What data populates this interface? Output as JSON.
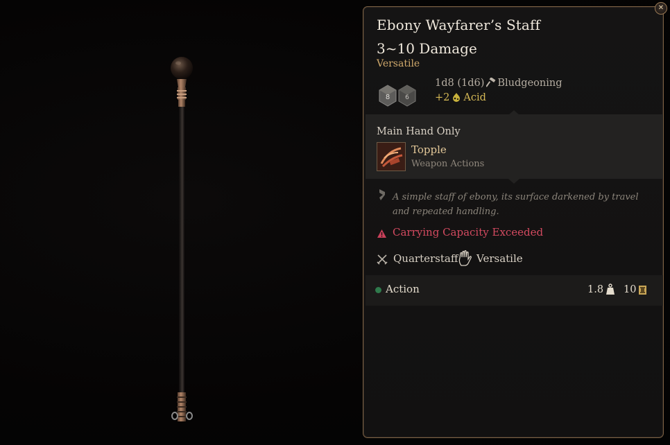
{
  "item": {
    "name": "Ebony Wayfarer’s Staff",
    "damage": "3~10 Damage",
    "property": "Versatile",
    "damage_dice": "1d8 (1d6)",
    "damage_type": "Bludgeoning",
    "bonus_damage": "+2",
    "bonus_type": "Acid",
    "dice_faces": [
      "8",
      "6"
    ]
  },
  "equip": {
    "slot": "Main Hand Only",
    "action_name": "Topple",
    "action_category": "Weapon Actions"
  },
  "description": "A simple staff of ebony, its surface darkened by travel and repeated handling.",
  "warning": "Carrying Capacity Exceeded",
  "proficiency": {
    "weapon_type": "Quarterstaff",
    "property": "Versatile"
  },
  "footer": {
    "action_type": "Action",
    "weight": "1.8",
    "value": "10"
  },
  "icons": {
    "close": "close-icon",
    "hammer": "bludgeoning-icon",
    "acid": "acid-icon",
    "description": "scroll-icon",
    "warning": "warning-icon",
    "quarterstaff": "crossed-swords-icon",
    "versatile": "hand-icon",
    "weight": "weight-icon",
    "value": "gold-icon"
  },
  "colors": {
    "gold_text": "#d1aa6c",
    "acid_text": "#d6ba56",
    "warning_text": "#d44a60",
    "action_dot": "#2f7a4c",
    "panel_border": "#7c6144"
  }
}
